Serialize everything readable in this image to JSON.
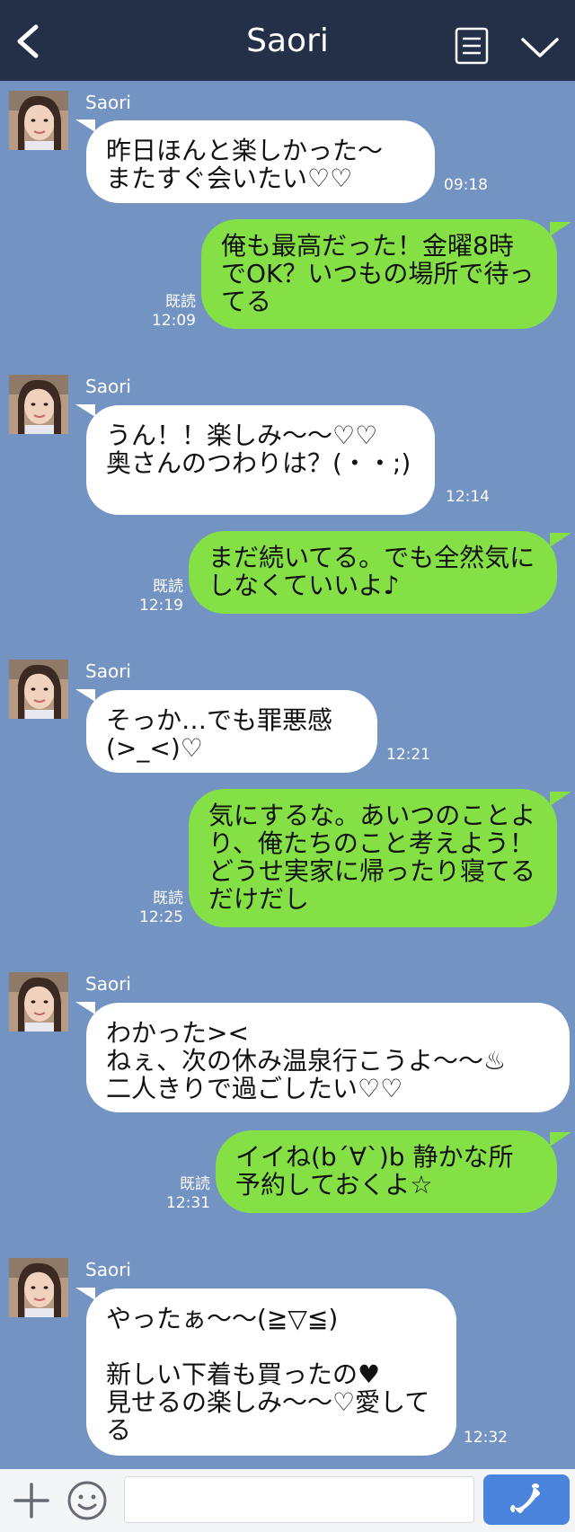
{
  "header": {
    "title": "Saori"
  },
  "messages": [
    {
      "sender": "Saori",
      "text": "昨日ほんと楽しかった〜\nまたすぐ会いたい♡♡",
      "time": "09:18"
    },
    {
      "text": "俺も最高だった！金曜8時でOK？いつもの場所で待ってる",
      "read": "既読",
      "time": "12:09"
    },
    {
      "sender": "Saori",
      "text": "うん！！楽しみ〜〜♡♡\n奥さんのつわりは？(・・;)",
      "time": "12:14"
    },
    {
      "text": "まだ続いてる。でも全然気にしなくていいよ♪",
      "read": "既読",
      "time": "12:19"
    },
    {
      "sender": "Saori",
      "text": "そっか…でも罪悪感(>_<)♡",
      "time": "12:21"
    },
    {
      "text": "気にするな。あいつのことより、俺たちのこと考えよう！どうせ実家に帰ったり寝てるだけだし",
      "read": "既読",
      "time": "12:25"
    },
    {
      "sender": "Saori",
      "text": "わかった><\nねぇ、次の休み温泉行こうよ〜〜♨\n二人きりで過ごしたい♡♡",
      "time": ""
    },
    {
      "text": "イイね(b´∀`)b 静かな所予約しておくよ☆",
      "read": "既読",
      "time": "12:31"
    },
    {
      "sender": "Saori",
      "text": "やったぁ〜〜(≧▽≦)\n\n新しい下着も買ったの♥\n見せるの楽しみ〜〜♡愛してる",
      "time": "12:32"
    }
  ],
  "footer": {
    "input_placeholder": ""
  }
}
